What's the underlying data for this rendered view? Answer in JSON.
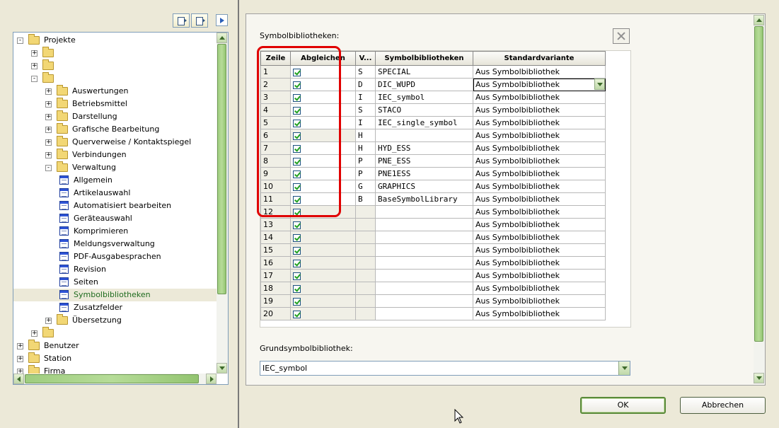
{
  "toolbar": {
    "left_buttons": [
      "panel-left-icon",
      "panel-right-icon"
    ],
    "right_button": "play-icon"
  },
  "tree": {
    "items": [
      {
        "level": 0,
        "exp": "-",
        "icon": "folder",
        "label": "Projekte"
      },
      {
        "level": 1,
        "exp": "+",
        "icon": "folder",
        "label": ""
      },
      {
        "level": 1,
        "exp": "+",
        "icon": "folder",
        "label": ""
      },
      {
        "level": 1,
        "exp": "-",
        "icon": "folder",
        "label": ""
      },
      {
        "level": 2,
        "exp": "+",
        "icon": "folder",
        "label": "Auswertungen"
      },
      {
        "level": 2,
        "exp": "+",
        "icon": "folder",
        "label": "Betriebsmittel"
      },
      {
        "level": 2,
        "exp": "+",
        "icon": "folder",
        "label": "Darstellung"
      },
      {
        "level": 2,
        "exp": "+",
        "icon": "folder",
        "label": "Grafische Bearbeitung"
      },
      {
        "level": 2,
        "exp": "+",
        "icon": "folder",
        "label": "Querverweise / Kontaktspiegel"
      },
      {
        "level": 2,
        "exp": "+",
        "icon": "folder",
        "label": "Verbindungen"
      },
      {
        "level": 2,
        "exp": "-",
        "icon": "folder",
        "label": "Verwaltung"
      },
      {
        "level": 3,
        "exp": "",
        "icon": "form",
        "label": "Allgemein"
      },
      {
        "level": 3,
        "exp": "",
        "icon": "form",
        "label": "Artikelauswahl"
      },
      {
        "level": 3,
        "exp": "",
        "icon": "form",
        "label": "Automatisiert bearbeiten"
      },
      {
        "level": 3,
        "exp": "",
        "icon": "form",
        "label": "Geräteauswahl"
      },
      {
        "level": 3,
        "exp": "",
        "icon": "form",
        "label": "Komprimieren"
      },
      {
        "level": 3,
        "exp": "",
        "icon": "form",
        "label": "Meldungsverwaltung"
      },
      {
        "level": 3,
        "exp": "",
        "icon": "form",
        "label": "PDF-Ausgabesprachen"
      },
      {
        "level": 3,
        "exp": "",
        "icon": "form",
        "label": "Revision"
      },
      {
        "level": 3,
        "exp": "",
        "icon": "form",
        "label": "Seiten"
      },
      {
        "level": 3,
        "exp": "",
        "icon": "form",
        "label": "Symbolbibliotheken",
        "selected": true
      },
      {
        "level": 3,
        "exp": "",
        "icon": "form",
        "label": "Zusatzfelder"
      },
      {
        "level": 2,
        "exp": "+",
        "icon": "folder",
        "label": "Übersetzung"
      },
      {
        "level": 1,
        "exp": "+",
        "icon": "folder",
        "label": ""
      },
      {
        "level": 0,
        "exp": "+",
        "icon": "folder",
        "label": "Benutzer"
      },
      {
        "level": 0,
        "exp": "+",
        "icon": "folder",
        "label": "Station"
      },
      {
        "level": 0,
        "exp": "+",
        "icon": "folder",
        "label": "Firma"
      }
    ]
  },
  "section_label": "Symbolbibliotheken:",
  "grid": {
    "headers": [
      "Zeile",
      "Abgleichen",
      "V...",
      "Symbolbibliotheken",
      "Standardvariante"
    ],
    "rows": [
      {
        "zeile": "1",
        "abgleichen": true,
        "v": "S",
        "lib": "SPECIAL",
        "variant": "Aus Symbolbibliothek"
      },
      {
        "zeile": "2",
        "abgleichen": true,
        "v": "D",
        "lib": "DIC_WUPD",
        "variant": "Aus Symbolbibliothek",
        "dropdown": true
      },
      {
        "zeile": "3",
        "abgleichen": true,
        "v": "I",
        "lib": "IEC_symbol",
        "variant": "Aus Symbolbibliothek"
      },
      {
        "zeile": "4",
        "abgleichen": true,
        "v": "S",
        "lib": "STACO",
        "variant": "Aus Symbolbibliothek"
      },
      {
        "zeile": "5",
        "abgleichen": true,
        "v": "I",
        "lib": "IEC_single_symbol",
        "variant": "Aus Symbolbibliothek"
      },
      {
        "zeile": "6",
        "abgleichen": true,
        "v": "H",
        "lib": "",
        "variant": "Aus Symbolbibliothek"
      },
      {
        "zeile": "7",
        "abgleichen": true,
        "v": "H",
        "lib": "HYD_ESS",
        "variant": "Aus Symbolbibliothek"
      },
      {
        "zeile": "8",
        "abgleichen": true,
        "v": "P",
        "lib": "PNE_ESS",
        "variant": "Aus Symbolbibliothek"
      },
      {
        "zeile": "9",
        "abgleichen": true,
        "v": "P",
        "lib": "PNE1ESS",
        "variant": "Aus Symbolbibliothek"
      },
      {
        "zeile": "10",
        "abgleichen": true,
        "v": "G",
        "lib": "GRAPHICS",
        "variant": "Aus Symbolbibliothek"
      },
      {
        "zeile": "11",
        "abgleichen": true,
        "v": "B",
        "lib": "BaseSymbolLibrary",
        "variant": "Aus Symbolbibliothek"
      },
      {
        "zeile": "12",
        "abgleichen": true,
        "v": "",
        "lib": "",
        "variant": "Aus Symbolbibliothek"
      },
      {
        "zeile": "13",
        "abgleichen": true,
        "v": "",
        "lib": "",
        "variant": "Aus Symbolbibliothek"
      },
      {
        "zeile": "14",
        "abgleichen": true,
        "v": "",
        "lib": "",
        "variant": "Aus Symbolbibliothek"
      },
      {
        "zeile": "15",
        "abgleichen": true,
        "v": "",
        "lib": "",
        "variant": "Aus Symbolbibliothek"
      },
      {
        "zeile": "16",
        "abgleichen": true,
        "v": "",
        "lib": "",
        "variant": "Aus Symbolbibliothek"
      },
      {
        "zeile": "17",
        "abgleichen": true,
        "v": "",
        "lib": "",
        "variant": "Aus Symbolbibliothek"
      },
      {
        "zeile": "18",
        "abgleichen": true,
        "v": "",
        "lib": "",
        "variant": "Aus Symbolbibliothek"
      },
      {
        "zeile": "19",
        "abgleichen": true,
        "v": "",
        "lib": "",
        "variant": "Aus Symbolbibliothek"
      },
      {
        "zeile": "20",
        "abgleichen": true,
        "v": "",
        "lib": "",
        "variant": "Aus Symbolbibliothek"
      }
    ]
  },
  "grund": {
    "label": "Grundsymbolbibliothek:",
    "value": "IEC_symbol"
  },
  "buttons": {
    "ok": "OK",
    "cancel": "Abbrechen"
  },
  "colors": {
    "highlight": "#e00000",
    "check": "#21a121",
    "selected_text": "#1e6b1e"
  }
}
